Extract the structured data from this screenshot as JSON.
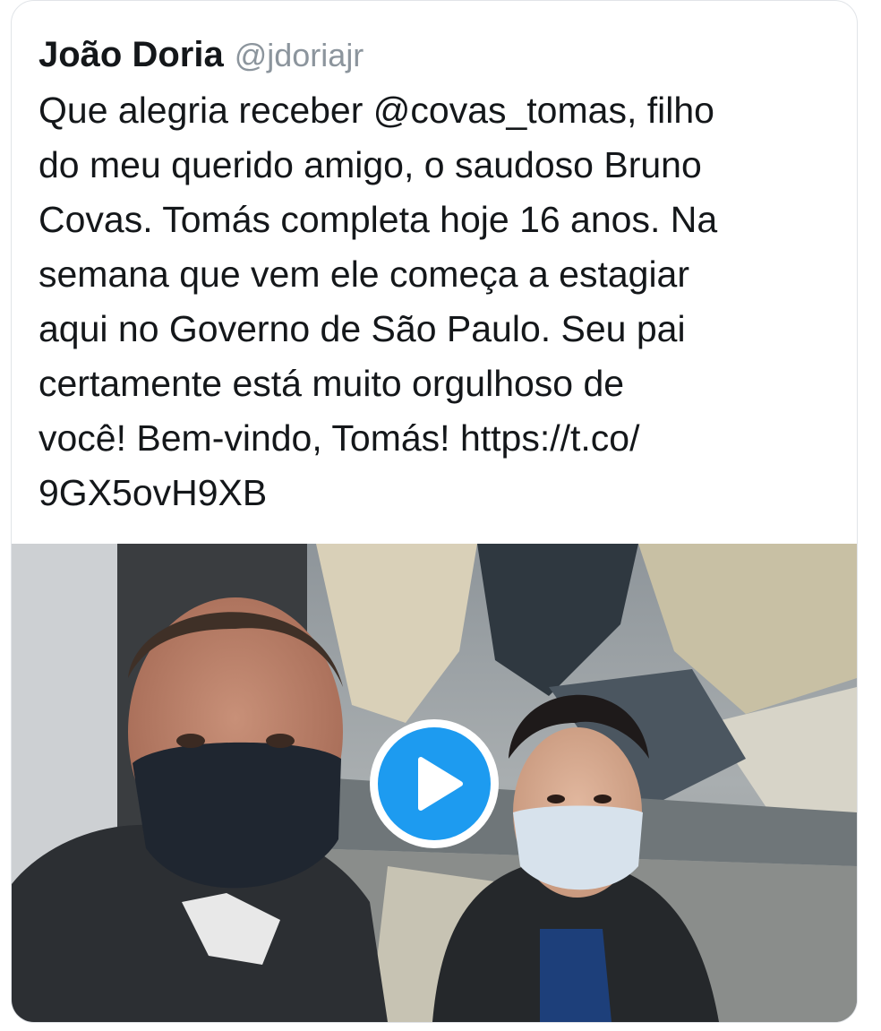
{
  "tweet": {
    "author": {
      "name": "João Doria",
      "handle": "@jdoriajr"
    },
    "text_lines": [
      "Que alegria receber @covas_tomas, filho",
      "do meu querido amigo, o saudoso Bruno",
      "Covas. Tomás completa hoje 16 anos. Na",
      "semana que vem ele começa a estagiar",
      "aqui no Governo de São Paulo. Seu pai",
      "certamente está muito orgulhoso de",
      "você! Bem-vindo, Tomás! https://t.co/",
      "9GX5ovH9XB"
    ],
    "media": {
      "type": "video",
      "icon": "play-icon"
    }
  },
  "colors": {
    "text": "#14171a",
    "handle": "#8c959d",
    "play_button": "#1d9bf0",
    "card_border": "#e1e4e8"
  }
}
